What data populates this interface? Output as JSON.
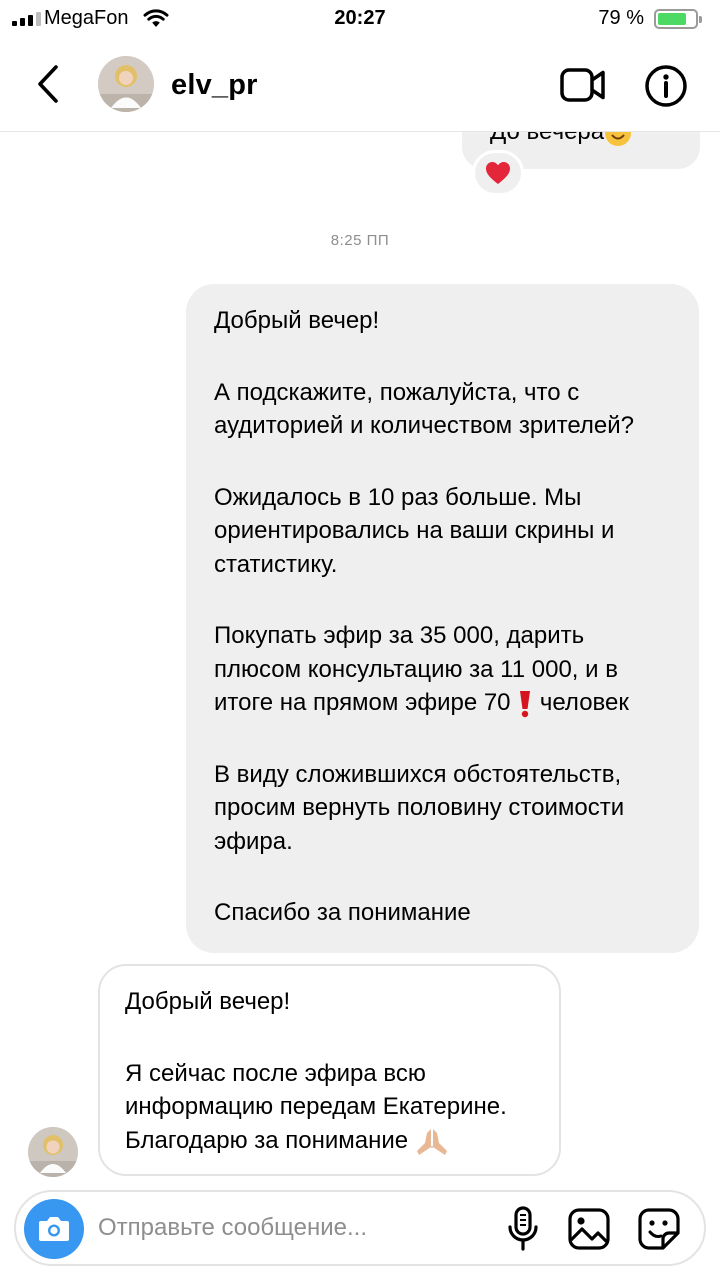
{
  "status_bar": {
    "carrier": "MegaFon",
    "time": "20:27",
    "battery_percent": "79 %",
    "battery_level": 0.79,
    "signal_bars": 3
  },
  "header": {
    "username": "elv_pr",
    "back_icon": "chevron-left-icon",
    "video_icon": "video-call-icon",
    "info_icon": "info-icon"
  },
  "chat": {
    "previous_message": {
      "text": "До вечера",
      "emoji": "smile-emoji",
      "reaction": "heart-emoji"
    },
    "timestamp": "8:25 ПП",
    "outgoing_message": {
      "paragraphs": [
        "Добрый вечер!",
        "А подскажите, пожалуйста, что с\nаудиторией и количеством зрителей?",
        "Ожидалось в 10 раз больше. Мы\nориентировались на ваши скрины и\nстатистику.",
        "В виду сложившихся обстоятельств,\nпросим вернуть половину стоимости\nэфира.",
        "Спасибо за понимание"
      ],
      "price_paragraph": {
        "before_emoji": "Покупать эфир за 35 000, дарить\nплюсом консультацию за 11 000,  и в\nитоге на прямом эфире 70",
        "emoji": "exclamation-emoji",
        "after_emoji": " человек"
      }
    },
    "incoming_message": {
      "greeting": "Добрый вечер!",
      "body": "Я сейчас после эфира всю\nинформацию передам Екатерине.\nБлагодарю за понимание",
      "emoji": "folded-hands-emoji"
    }
  },
  "composer": {
    "placeholder": "Отправьте сообщение...",
    "camera_icon": "camera-icon",
    "mic_icon": "microphone-icon",
    "gallery_icon": "gallery-icon",
    "sticker_icon": "sticker-icon",
    "accent_color": "#3897f0"
  }
}
